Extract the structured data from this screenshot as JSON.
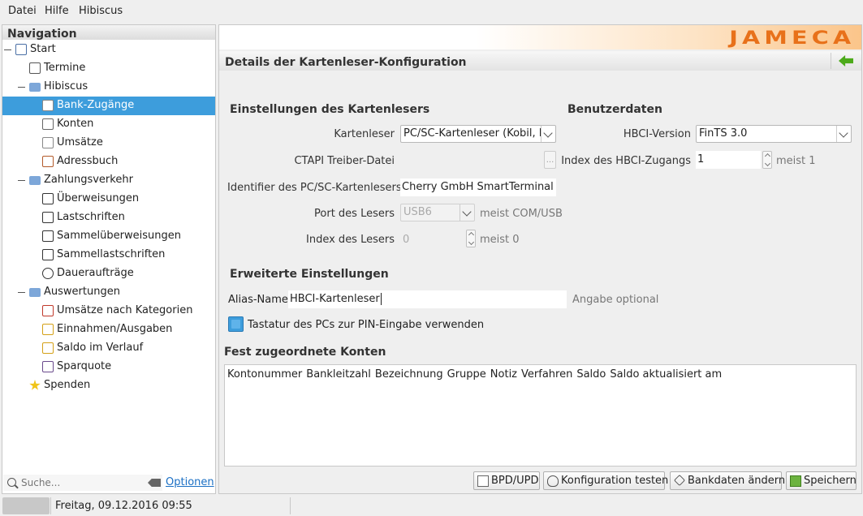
{
  "menubar": {
    "items": [
      "Datei",
      "Hilfe",
      "Hibiscus"
    ]
  },
  "navigation": {
    "title": "Navigation",
    "items": [
      {
        "label": "Start",
        "icon": "computer-icon"
      },
      {
        "label": "Termine",
        "icon": "calendar-icon"
      },
      {
        "label": "Hibiscus",
        "icon": "folder-icon"
      },
      {
        "label": "Bank-Zugänge",
        "icon": "wrench-icon"
      },
      {
        "label": "Konten",
        "icon": "account-icon"
      },
      {
        "label": "Umsätze",
        "icon": "document-icon"
      },
      {
        "label": "Adressbuch",
        "icon": "address-book-icon"
      },
      {
        "label": "Zahlungsverkehr",
        "icon": "folder-icon"
      },
      {
        "label": "Überweisungen",
        "icon": "transfer-out-icon"
      },
      {
        "label": "Lastschriften",
        "icon": "debit-icon"
      },
      {
        "label": "Sammelüberweisungen",
        "icon": "batch-transfer-icon"
      },
      {
        "label": "Sammellastschriften",
        "icon": "batch-debit-icon"
      },
      {
        "label": "Daueraufträge",
        "icon": "clock-icon"
      },
      {
        "label": "Auswertungen",
        "icon": "folder-icon"
      },
      {
        "label": "Umsätze nach Kategorien",
        "icon": "category-chart-icon"
      },
      {
        "label": "Einnahmen/Ausgaben",
        "icon": "income-expense-icon"
      },
      {
        "label": "Saldo im Verlauf",
        "icon": "balance-history-icon"
      },
      {
        "label": "Sparquote",
        "icon": "savings-chart-icon"
      },
      {
        "label": "Spenden",
        "icon": "star-icon"
      }
    ],
    "selected": "Bank-Zugänge"
  },
  "search": {
    "placeholder": "Suche...",
    "options_label": "Optionen"
  },
  "detail": {
    "title": "Details der Kartenleser-Konfiguration",
    "reader_settings": {
      "title": "Einstellungen des Kartenlesers",
      "kartenleser_label": "Kartenleser",
      "kartenleser_value": "PC/SC-Kartenleser (Kobil, Re",
      "ctapi_label": "CTAPI Treiber-Datei",
      "ctapi_button": "...",
      "identifier_label": "Identifier des PC/SC-Kartenlesers",
      "identifier_value": "Cherry GmbH SmartTerminal XX",
      "port_label": "Port des Lesers",
      "port_value": "USB6",
      "port_hint": "meist COM/USB",
      "index_label": "Index des Lesers",
      "index_value": "0",
      "index_hint": "meist 0"
    },
    "user_data": {
      "title": "Benutzerdaten",
      "hbci_version_label": "HBCI-Version",
      "hbci_version_value": "FinTS 3.0",
      "hbci_index_label": "Index des HBCI-Zugangs",
      "hbci_index_value": "1",
      "hbci_index_hint": "meist 1"
    },
    "advanced": {
      "title": "Erweiterte Einstellungen",
      "alias_label": "Alias-Name",
      "alias_value": "HBCI-Kartenleser",
      "alias_hint": "Angabe optional",
      "keyboard_label": "Tastatur des PCs zur PIN-Eingabe verwenden",
      "keyboard_checked": true
    },
    "accounts": {
      "title": "Fest zugeordnete Konten",
      "columns": [
        "Kontonummer",
        "Bankleitzahl",
        "Bezeichnung",
        "Gruppe",
        "Notiz",
        "Verfahren",
        "Saldo",
        "Saldo aktualisiert am"
      ]
    },
    "buttons": {
      "bpd": "BPD/UPD",
      "test": "Konfiguration testen",
      "bankdata": "Bankdaten ändern",
      "save": "Speichern"
    }
  },
  "statusbar": {
    "date": "Freitag, 09.12.2016 09:55"
  },
  "branding": {
    "logo_text": "JAMECA",
    "accent": "#e8711a",
    "selection": "#3d9ddc"
  }
}
